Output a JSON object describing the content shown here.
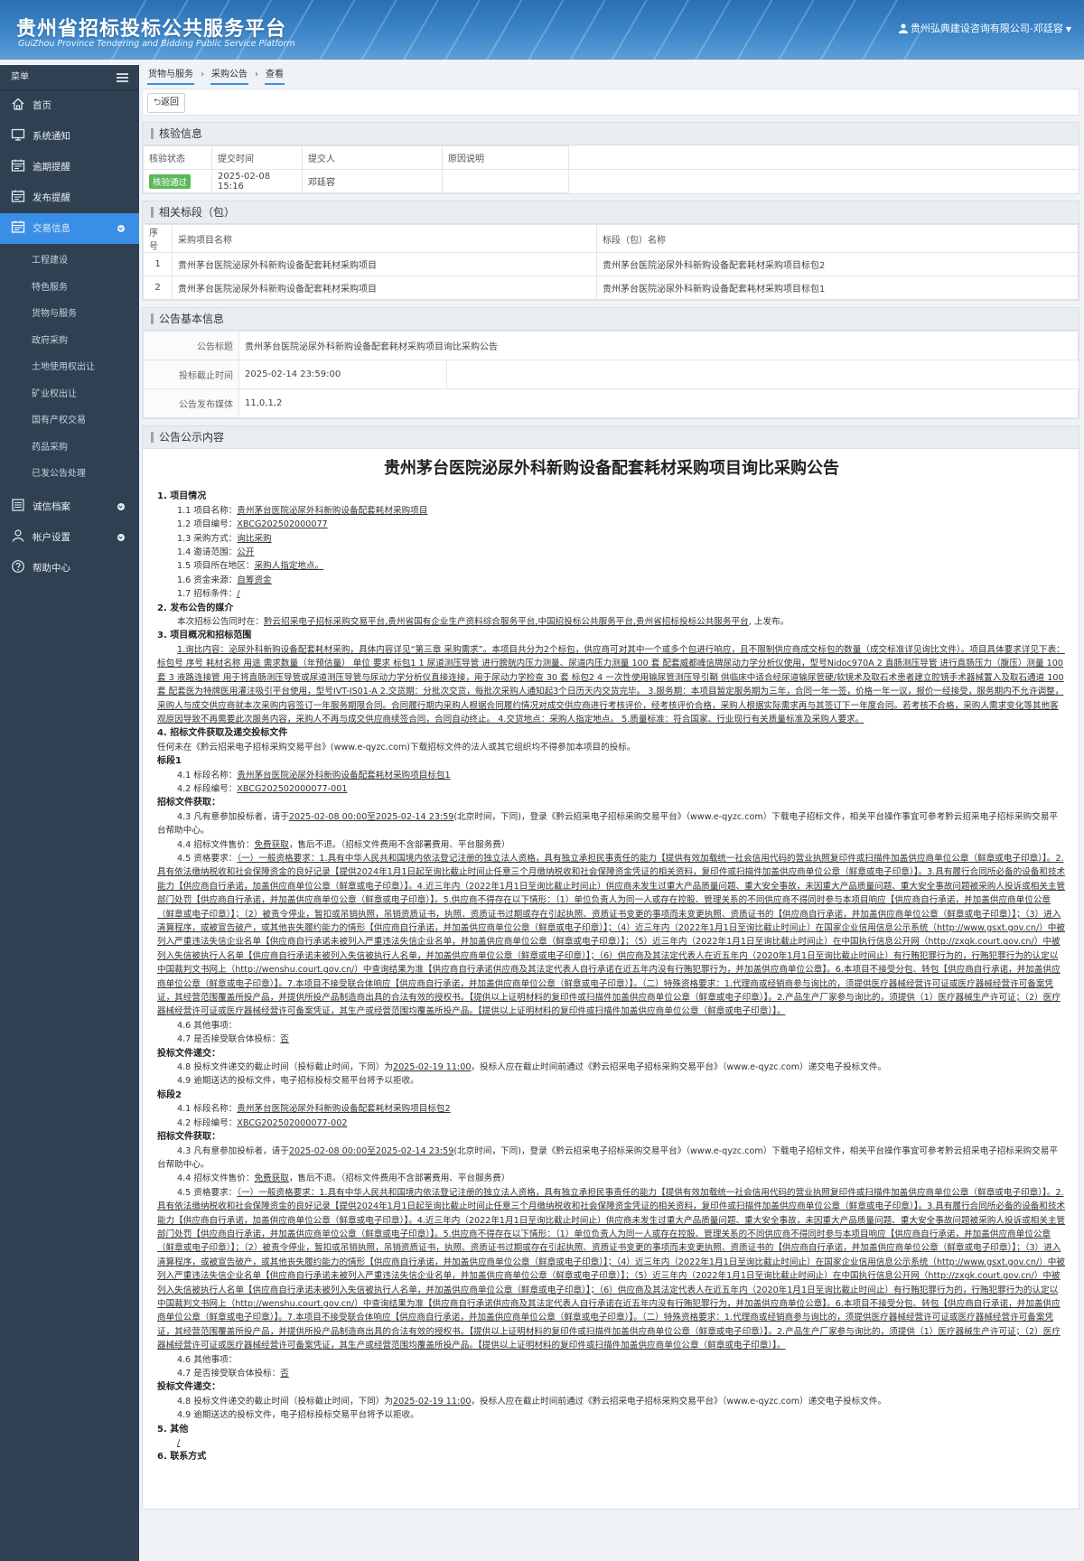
{
  "header": {
    "title": "贵州省招标投标公共服务平台",
    "subtitle": "GuiZhou Province Tendering and Bidding Public Service Platform",
    "user": "贵州弘典建设咨询有限公司-邓廷容"
  },
  "sidebar": {
    "heading": "菜单",
    "items": [
      {
        "label": "首页",
        "icon": "home-icon"
      },
      {
        "label": "系统通知",
        "icon": "monitor-icon"
      },
      {
        "label": "逾期提醒",
        "icon": "calendar-icon"
      },
      {
        "label": "发布提醒",
        "icon": "calendar-icon"
      },
      {
        "label": "交易信息",
        "icon": "calendar-icon"
      }
    ],
    "sub_items": [
      "工程建设",
      "特色服务",
      "货物与服务",
      "政府采购",
      "土地使用权出让",
      "矿业权出让",
      "国有产权交易",
      "药品采购",
      "已发公告处理"
    ],
    "bottom_items": [
      {
        "label": "诚信档案",
        "icon": "list-icon"
      },
      {
        "label": "帐户设置",
        "icon": "user-icon"
      },
      {
        "label": "帮助中心",
        "icon": "help-icon"
      }
    ]
  },
  "breadcrumb": [
    "货物与服务",
    "采购公告",
    "查看"
  ],
  "toolbar": {
    "back_label": "返回"
  },
  "verify": {
    "title": "核验信息",
    "headers": [
      "核验状态",
      "提交时间",
      "提交人",
      "原因说明"
    ],
    "row": {
      "status": "核验通过",
      "time": "2025-02-08 15:16",
      "person": "邓廷容",
      "reason": ""
    }
  },
  "sections": {
    "title": "相关标段（包）",
    "headers": [
      "序号",
      "采购项目名称",
      "标段（包）名称"
    ],
    "rows": [
      {
        "no": "1",
        "project": "贵州茅台医院泌尿外科新购设备配套耗材采购项目",
        "section": "贵州茅台医院泌尿外科新购设备配套耗材采购项目标包2"
      },
      {
        "no": "2",
        "project": "贵州茅台医院泌尿外科新购设备配套耗材采购项目",
        "section": "贵州茅台医院泌尿外科新购设备配套耗材采购项目标包1"
      }
    ]
  },
  "basic": {
    "title": "公告基本信息",
    "label_title": "公告标题",
    "value_title": "贵州茅台医院泌尿外科新购设备配套耗材采购项目询比采购公告",
    "label_deadline": "投标截止时间",
    "value_deadline": "2025-02-14 23:59:00",
    "label_media": "公告发布媒体",
    "value_media": "11,0,1,2"
  },
  "notice": {
    "panel_title": "公告公示内容",
    "title": "贵州茅台医院泌尿外科新购设备配套耗材采购项目询比采购公告",
    "h1": "1. 项目情况",
    "items1": [
      [
        "1.1 项目名称：",
        "贵州茅台医院泌尿外科新购设备配套耗材采购项目"
      ],
      [
        "1.2 项目编号：",
        "XBCG202502000077"
      ],
      [
        "1.3 采购方式：",
        "询比采购"
      ],
      [
        "1.4 邀请范围：",
        "公开"
      ],
      [
        "1.5 项目所在地区：",
        "采购人指定地点。"
      ],
      [
        "1.6 资金来源：",
        "自筹资金"
      ],
      [
        "1.7 招标条件：",
        "/"
      ]
    ],
    "h2": "2. 发布公告的媒介",
    "media_prefix": "本次招标公告同时在：",
    "media_value": "黔云招采电子招标采购交易平台,贵州省国有企业生产资料综合服务平台,中国招投标公共服务平台,贵州省招标投标公共服务平台",
    "media_suffix": "上发布。",
    "h3": "3. 项目概况和招标范围",
    "scope": "1.询比内容：泌尿外科新购设备配套耗材采购，具体内容详见“第三章 采购需求”。本项目共分为2个标包，供应商可对其中一个或多个包进行响应，且不限制供应商成交标包的数量（成交标准详见询比文件）。项目具体要求详见下表： 标包号 序号 耗材名称 用途 需求数量（年预估量） 单位 要求 标包1 1 尿道测压导管 进行膀胱内压力测量、尿道内压力测量 100 套 配套威都峰信牌尿动力学分析仪使用，型号Nidoc970A 2 直肠测压导管 进行直肠压力（腹压）测量 100 套 3 液路连接管 用于将直肠测压导管或尿道测压导管与尿动力学分析仪直接连接，用于尿动力学检查 30 套 标包2 4 一次性使用输尿管测压导引鞘 供临床中适合经尿道输尿管硬/软镜术及取石术患者建立腔镜手术器械置入及取石通道 100 套 配套医为特牌医用灌注吸引平台使用，型号IVT-IS01-A 2.交货期：分批次交货，每批次采购人通知起3个日历天内交货完毕。 3.服务期：本项目暂定服务期为三年，合同一年一签，价格一年一议，报价一经接受，服务期内不允许调整，采购人与成交供应商就本次采购内容签订一年服务期限合同。合同履行期内采购人根据合同履约情况对成交供应商进行考核评价，经考核评价合格，采购人根据实际需求再与其签订下一年度合同。若考核不合格，采购人需求变化等其他客观原因导致不再需要此次服务内容，采购人不再与成交供应商续签合同，合同自动终止。 4.交货地点：采购人指定地点。 5.质量标准：符合国家、行业现行有关质量标准及采购人要求。",
    "h4": "4. 招标文件获取及递交投标文件",
    "rule": "任何未在《黔云招采电子招标采购交易平台》(www.e-qyzc.com)下载招标文件的法人或其它组织均不得参加本项目的投标。",
    "lots": [
      {
        "name": "标段1",
        "n1": "4.1 标段名称：",
        "v1": "贵州茅台医院泌尿外科新购设备配套耗材采购项目标包1",
        "n2": "4.2 标段编号：",
        "v2": "XBCG202502000077-001",
        "get": "招标文件获取：",
        "g43a": "4.3 凡有意参加投标者，请于",
        "g43s": "2025-02-08 00:00",
        "g43m": "至",
        "g43e": "2025-02-14 23:59",
        "g43b": "(北京时间，下同)，登录《黔云招采电子招标采购交易平台》（www.e-qyzc.com）下载电子招标文件，相关平台操作事宜可参考黔云招采电子招标采购交易平台帮助中心。",
        "g44a": "4.4 招标文件售价：",
        "g44v": "免费获取",
        "g44b": "，售后不退。（招标文件费用不含部署费用、平台服务费）",
        "g45a": "4.5 资格要求：",
        "g45": "（一）一般资格要求：1.具有中华人民共和国境内依法登记注册的独立法人资格，具有独立承担民事责任的能力【提供有效加载统一社会信用代码的营业执照复印件或扫描件加盖供应商单位公章（鲜章或电子印章）】。2.具有依法缴纳税收和社会保障资金的良好记录【提供2024年1月1日起至询比截止时间止任意三个月缴纳税收和社会保障资金凭证的相关资料，复印件或扫描件加盖供应商单位公章（鲜章或电子印章）】。3.具有履行合同所必备的设备和技术能力【供应商自行承诺，加盖供应商单位公章（鲜章或电子印章）】。4.近三年内（2022年1月1日至询比截止时间止）供应商未发生过重大产品质量问题、重大安全事故，未因重大产品质量问题、重大安全事故问题被采购人投诉或相关主管部门处罚【供应商自行承诺，并加盖供应商单位公章（鲜章或电子印章）】。5.供应商不得存在以下情形：（1）单位负责人为同一人或存在控股、管理关系的不同供应商不得同时参与本项目响应【供应商自行承诺，并加盖供应商单位公章（鲜章或电子印章）】；（2）被责令停业，暂扣或吊销执照，吊销资质证书，执照、资质证书过期或存在引起执照、资质证书变更的事项而未变更执照、资质证书的【供应商自行承诺，并加盖供应商单位公章（鲜章或电子印章）】；（3）进入清算程序，或被宣告破产，或其他丧失履约能力的情形【供应商自行承诺，并加盖供应商单位公章（鲜章或电子印章）】；（4）近三年内（2022年1月1日至询比截止时间止）在国家企业信用信息公示系统（http://www.gsxt.gov.cn/）中被列入严重违法失信企业名单【供应商自行承诺未被列入严重违法失信企业名单，并加盖供应商单位公章（鲜章或电子印章）】；（5）近三年内（2022年1月1日至询比截止时间止）在中国执行信息公开网（http://zxgk.court.gov.cn/）中被列入失信被执行人名单【供应商自行承诺未被列入失信被执行人名单，并加盖供应商单位公章（鲜章或电子印章）】；（6）供应商及其法定代表人在近五年内（2020年1月1日至询比截止时间止）有行贿犯罪行为的，行贿犯罪行为的认定以中国裁判文书网上（http://wenshu.court.gov.cn/）中查询结果为准【供应商自行承诺供应商及其法定代表人自行承诺在近五年内没有行贿犯罪行为，并加盖供应商单位公章】。6.本项目不接受分包、转包【供应商自行承诺，并加盖供应商单位公章（鲜章或电子印章）】。7.本项目不接受联合体响应【供应商自行承诺，并加盖供应商单位公章（鲜章或电子印章）】。（二）特殊资格要求：1.代理商或经销商参与询比的，须提供医疗器械经营许可证或医疗器械经营许可备案凭证，其经营范围覆盖所投产品，并提供所投产品制造商出具的合法有效的授权书。【提供以上证明材料的复印件或扫描件加盖供应商单位公章（鲜章或电子印章）】。2.产品生产厂家参与询比的，须提供（1）医疗器械生产许可证；（2）医疗器械经营许可证或医疗器械经营许可备案凭证，其生产或经营范围均覆盖所投产品。【提供以上证明材料的复印件或扫描件加盖供应商单位公章（鲜章或电子印章）】。",
        "g46": "4.6 其他事项：",
        "g47a": "4.7 是否接受联合体投标：",
        "g47v": "否",
        "sub": "投标文件递交：",
        "g48a": "4.8 投标文件递交的截止时间（投标截止时间，下同）为",
        "g48v": "2025-02-19 11:00",
        "g48b": "，投标人应在截止时间前通过《黔云招采电子招标采购交易平台》（www.e-qyzc.com）递交电子投标文件。",
        "g49": "4.9 逾期送达的投标文件，电子招标投标交易平台将予以拒收。"
      },
      {
        "name": "标段2",
        "n1": "4.1 标段名称：",
        "v1": "贵州茅台医院泌尿外科新购设备配套耗材采购项目标包2",
        "n2": "4.2 标段编号：",
        "v2": "XBCG202502000077-002",
        "get": "招标文件获取：",
        "g43a": "4.3 凡有意参加投标者，请于",
        "g43s": "2025-02-08 00:00",
        "g43m": "至",
        "g43e": "2025-02-14 23:59",
        "g43b": "(北京时间，下同)，登录《黔云招采电子招标采购交易平台》（www.e-qyzc.com）下载电子招标文件，相关平台操作事宜可参考黔云招采电子招标采购交易平台帮助中心。",
        "g44a": "4.4 招标文件售价：",
        "g44v": "免费获取",
        "g44b": "，售后不退。（招标文件费用不含部署费用、平台服务费）",
        "g45a": "4.5 资格要求：",
        "g45": "（一）一般资格要求：1.具有中华人民共和国境内依法登记注册的独立法人资格，具有独立承担民事责任的能力【提供有效加载统一社会信用代码的营业执照复印件或扫描件加盖供应商单位公章（鲜章或电子印章）】。2.具有依法缴纳税收和社会保障资金的良好记录【提供2024年1月1日起至询比截止时间止任意三个月缴纳税收和社会保障资金凭证的相关资料，复印件或扫描件加盖供应商单位公章（鲜章或电子印章）】。3.具有履行合同所必备的设备和技术能力【供应商自行承诺，加盖供应商单位公章（鲜章或电子印章）】。4.近三年内（2022年1月1日至询比截止时间止）供应商未发生过重大产品质量问题、重大安全事故，未因重大产品质量问题、重大安全事故问题被采购人投诉或相关主管部门处罚【供应商自行承诺，并加盖供应商单位公章（鲜章或电子印章）】。5.供应商不得存在以下情形：（1）单位负责人为同一人或存在控股、管理关系的不同供应商不得同时参与本项目响应【供应商自行承诺，并加盖供应商单位公章（鲜章或电子印章）】；（2）被责令停业，暂扣或吊销执照，吊销资质证书，执照、资质证书过期或存在引起执照、资质证书变更的事项而未变更执照、资质证书的【供应商自行承诺，并加盖供应商单位公章（鲜章或电子印章）】；（3）进入清算程序，或被宣告破产，或其他丧失履约能力的情形【供应商自行承诺，并加盖供应商单位公章（鲜章或电子印章）】；（4）近三年内（2022年1月1日至询比截止时间止）在国家企业信用信息公示系统（http://www.gsxt.gov.cn/）中被列入严重违法失信企业名单【供应商自行承诺未被列入严重违法失信企业名单，并加盖供应商单位公章（鲜章或电子印章）】；（5）近三年内（2022年1月1日至询比截止时间止）在中国执行信息公开网（http://zxgk.court.gov.cn/）中被列入失信被执行人名单【供应商自行承诺未被列入失信被执行人名单，并加盖供应商单位公章（鲜章或电子印章）】；（6）供应商及其法定代表人在近五年内（2020年1月1日至询比截止时间止）有行贿犯罪行为的，行贿犯罪行为的认定以中国裁判文书网上（http://wenshu.court.gov.cn/）中查询结果为准【供应商自行承诺供应商及其法定代表人自行承诺在近五年内没有行贿犯罪行为，并加盖供应商单位公章】。6.本项目不接受分包、转包【供应商自行承诺，并加盖供应商单位公章（鲜章或电子印章）】。7.本项目不接受联合体响应【供应商自行承诺，并加盖供应商单位公章（鲜章或电子印章）】。（二）特殊资格要求：1.代理商或经销商参与询比的，须提供医疗器械经营许可证或医疗器械经营许可备案凭证，其经营范围覆盖所投产品，并提供所投产品制造商出具的合法有效的授权书。【提供以上证明材料的复印件或扫描件加盖供应商单位公章（鲜章或电子印章）】。2.产品生产厂家参与询比的，须提供（1）医疗器械生产许可证；（2）医疗器械经营许可证或医疗器械经营许可备案凭证，其生产或经营范围均覆盖所投产品。【提供以上证明材料的复印件或扫描件加盖供应商单位公章（鲜章或电子印章）】。",
        "g46": "4.6 其他事项：",
        "g47a": "4.7 是否接受联合体投标：",
        "g47v": "否",
        "sub": "投标文件递交：",
        "g48a": "4.8 投标文件递交的截止时间（投标截止时间，下同）为",
        "g48v": "2025-02-19 11:00",
        "g48b": "，投标人应在截止时间前通过《黔云招采电子招标采购交易平台》（www.e-qyzc.com）递交电子投标文件。",
        "g49": "4.9 逾期送达的投标文件，电子招标投标交易平台将予以拒收。"
      }
    ],
    "h5": "5. 其他",
    "other": "/",
    "h6": "6. 联系方式"
  }
}
